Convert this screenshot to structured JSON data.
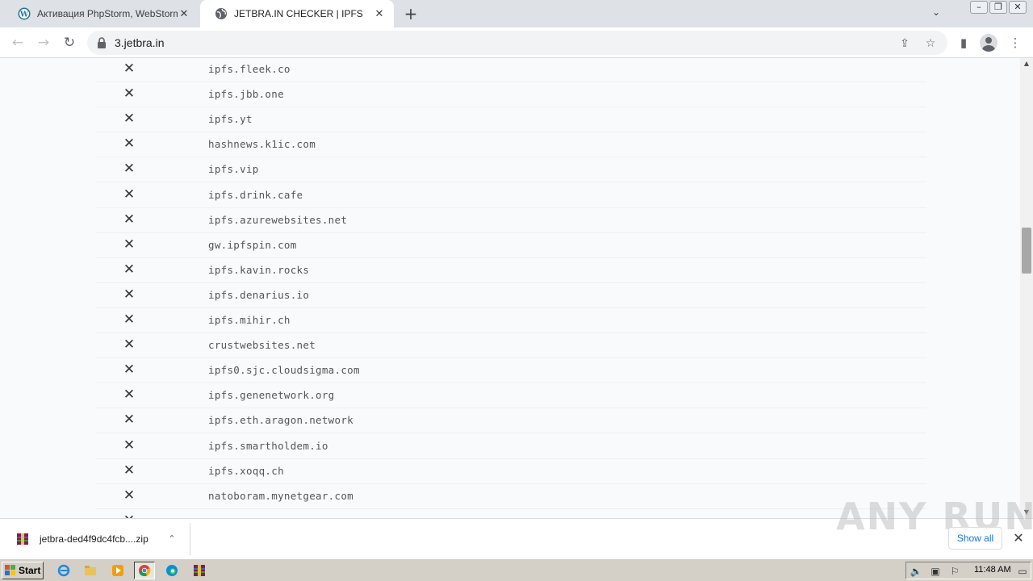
{
  "browser": {
    "tabs": [
      {
        "title": "Активация PhpStorm, WebStorm, Int",
        "favicon": "wordpress-icon",
        "active": false
      },
      {
        "title": "JETBRA.IN CHECKER | IPFS",
        "favicon": "globe-icon",
        "active": true
      }
    ],
    "url": "3.jetbra.in"
  },
  "list": {
    "rows": [
      {
        "status": "✕",
        "host": "ipfs.fleek.co"
      },
      {
        "status": "✕",
        "host": "ipfs.jbb.one"
      },
      {
        "status": "✕",
        "host": "ipfs.yt"
      },
      {
        "status": "✕",
        "host": "hashnews.k1ic.com"
      },
      {
        "status": "✕",
        "host": "ipfs.vip"
      },
      {
        "status": "✕",
        "host": "ipfs.drink.cafe"
      },
      {
        "status": "✕",
        "host": "ipfs.azurewebsites.net"
      },
      {
        "status": "✕",
        "host": "gw.ipfspin.com"
      },
      {
        "status": "✕",
        "host": "ipfs.kavin.rocks"
      },
      {
        "status": "✕",
        "host": "ipfs.denarius.io"
      },
      {
        "status": "✕",
        "host": "ipfs.mihir.ch"
      },
      {
        "status": "✕",
        "host": "crustwebsites.net"
      },
      {
        "status": "✕",
        "host": "ipfs0.sjc.cloudsigma.com"
      },
      {
        "status": "✕",
        "host": "ipfs.genenetwork.org"
      },
      {
        "status": "✕",
        "host": "ipfs.eth.aragon.network"
      },
      {
        "status": "✕",
        "host": "ipfs.smartholdem.io"
      },
      {
        "status": "✕",
        "host": "ipfs.xoqq.ch"
      },
      {
        "status": "✕",
        "host": "natoboram.mynetgear.com"
      },
      {
        "status": "✕",
        "host": ""
      }
    ]
  },
  "downloads": {
    "filename": "jetbra-ded4f9dc4fcb....zip",
    "show_all": "Show all"
  },
  "watermark": "ANY RUN",
  "taskbar": {
    "start": "Start",
    "clock": "11:48 AM"
  }
}
